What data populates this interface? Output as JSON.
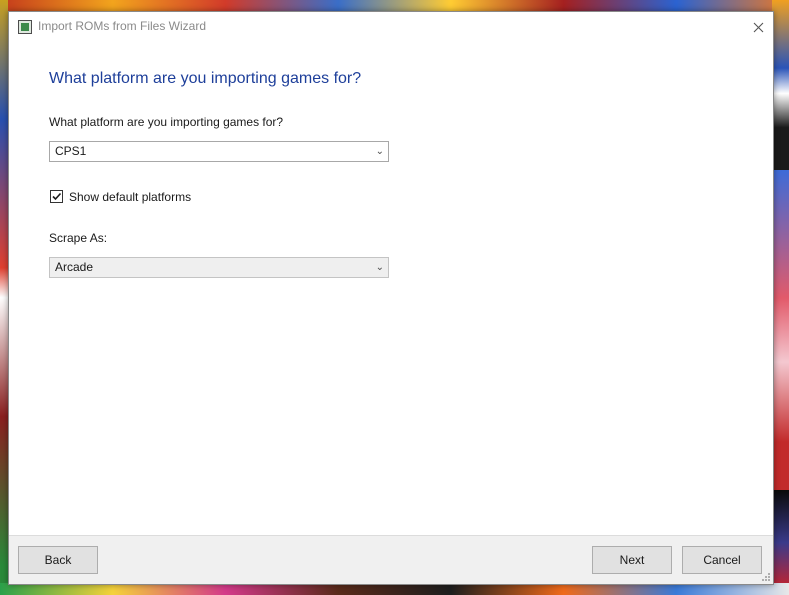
{
  "window": {
    "title": "Import ROMs from Files Wizard"
  },
  "page": {
    "heading": "What platform are you importing games for?",
    "platform_label": "What platform are you importing games for?",
    "platform_value": "CPS1",
    "show_default_label": "Show default platforms",
    "show_default_checked": true,
    "scrape_label": "Scrape As:",
    "scrape_value": "Arcade"
  },
  "footer": {
    "back_label": "Back",
    "next_label": "Next",
    "cancel_label": "Cancel"
  },
  "colors": {
    "heading": "#1e3f9a",
    "footer_bg": "#f0f0f0",
    "button_bg": "#e1e1e1"
  },
  "icons": [
    "app-icon",
    "close-icon",
    "chevron-down-icon",
    "checkmark-icon",
    "resize-grip-icon"
  ]
}
